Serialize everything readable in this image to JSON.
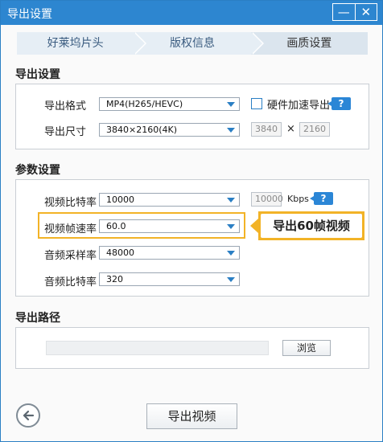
{
  "window": {
    "title": "导出设置",
    "minimize_label": "—",
    "close_label": "✕"
  },
  "steps": [
    {
      "label": "好莱坞片头"
    },
    {
      "label": "版权信息"
    },
    {
      "label": "画质设置"
    }
  ],
  "export_settings": {
    "section_title": "导出设置",
    "format_label": "导出格式",
    "format_value": "MP4(H265/HEVC)",
    "hw_accel_label": "硬件加速导出",
    "hw_accel_checked": false,
    "help_label": "?",
    "size_label": "导出尺寸",
    "size_value": "3840×2160(4K)",
    "width_value": "3840",
    "times_sign": "×",
    "height_value": "2160"
  },
  "params": {
    "section_title": "参数设置",
    "video_bitrate_label": "视频比特率",
    "video_bitrate_value": "10000",
    "bitrate_custom_value": "10000",
    "bitrate_unit": "Kbps",
    "help_label": "?",
    "framerate_label": "视频帧速率",
    "framerate_value": "60.0",
    "audio_samplerate_label": "音频采样率",
    "audio_samplerate_value": "48000",
    "audio_bitrate_label": "音频比特率",
    "audio_bitrate_value": "320"
  },
  "callout": {
    "text": "导出60帧视频"
  },
  "output_path": {
    "section_title": "导出路径",
    "path_value": "",
    "browse_label": "浏览"
  },
  "footer": {
    "export_button_label": "导出视频"
  },
  "colors": {
    "accent": "#2d86d0",
    "highlight": "#f2b327"
  }
}
